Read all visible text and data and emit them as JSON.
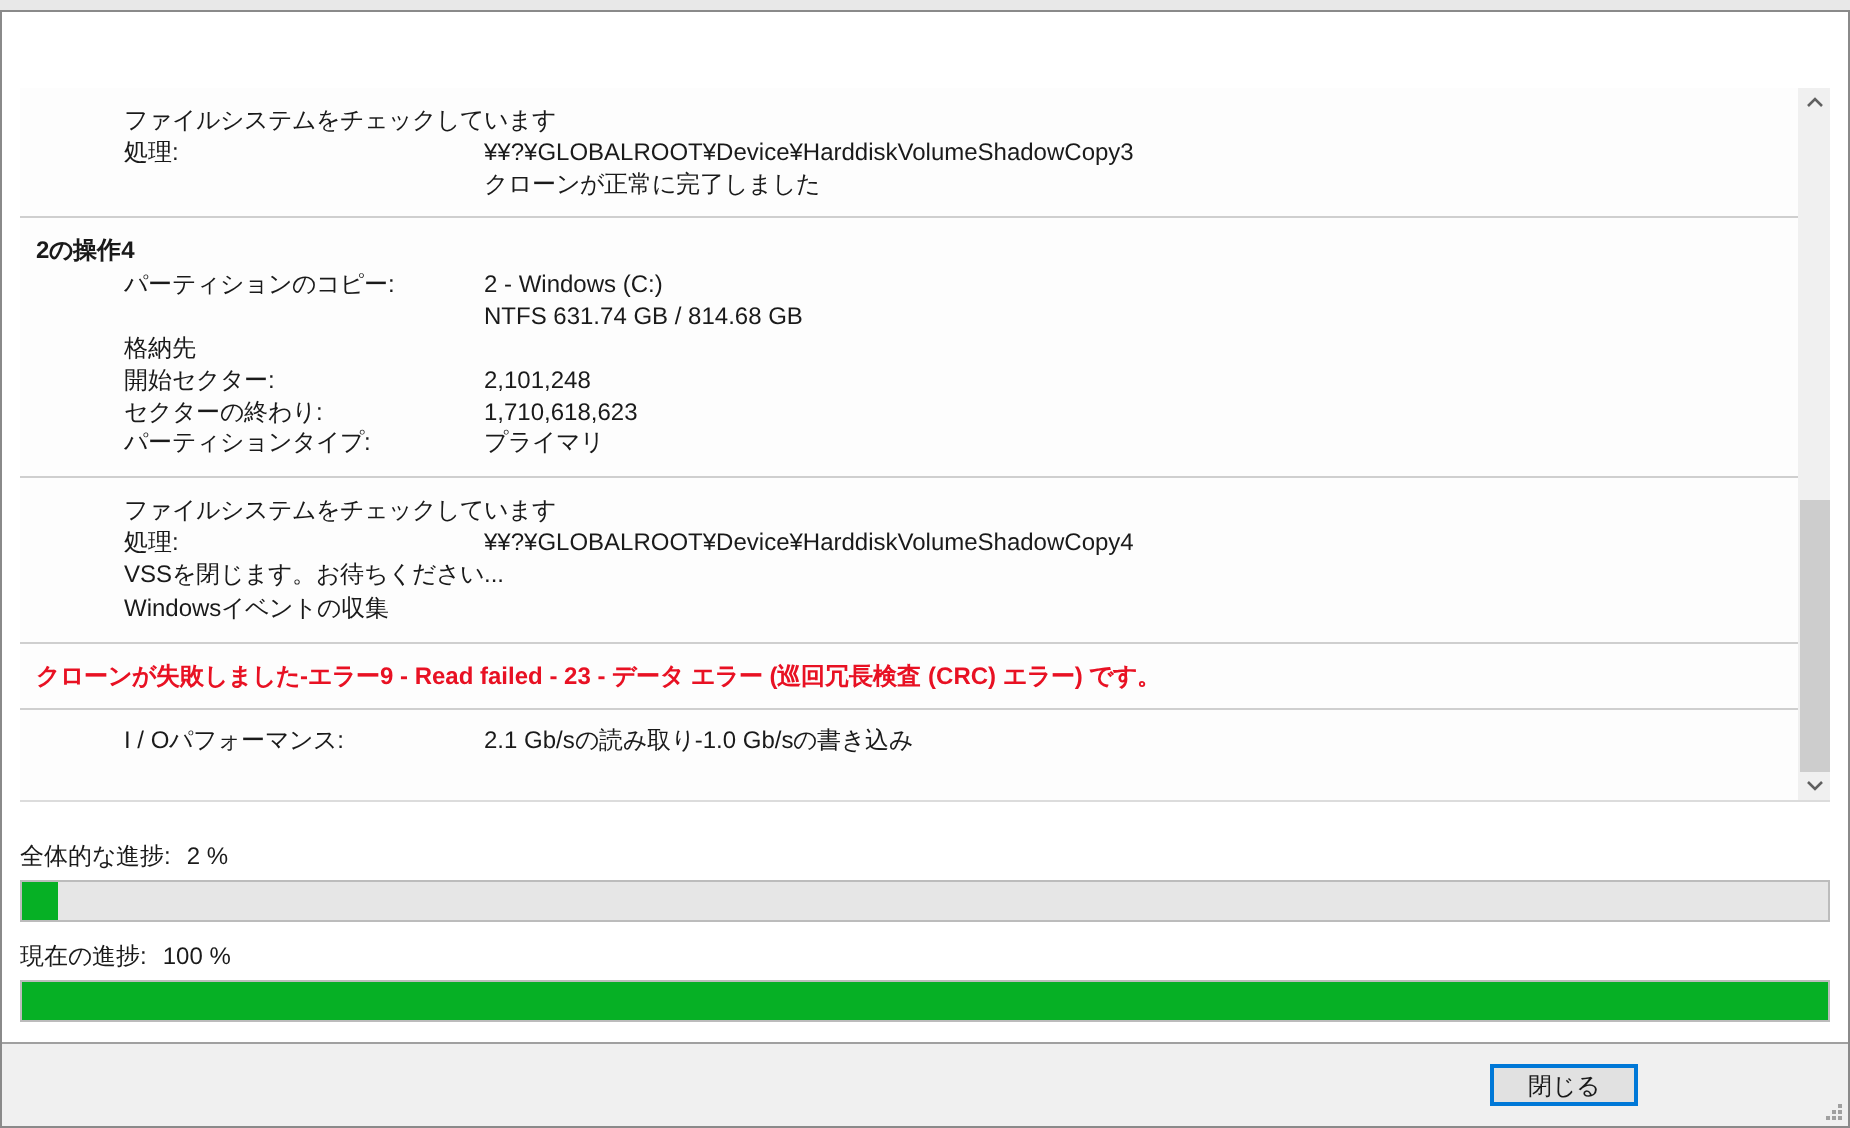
{
  "log": {
    "sections": [
      {
        "rows": [
          {
            "kind": "text",
            "text": "ファイルシステムをチェックしています"
          },
          {
            "kind": "pair",
            "label": "処理:",
            "values": [
              "¥¥?¥GLOBALROOT¥Device¥HarddiskVolumeShadowCopy3",
              "クローンが正常に完了しました"
            ]
          }
        ]
      },
      {
        "heading": "2の操作4",
        "rows": [
          {
            "kind": "pair",
            "label": "パーティションのコピー:",
            "values": [
              "2 - Windows (C:)",
              "NTFS 631.74 GB / 814.68 GB"
            ]
          },
          {
            "kind": "text",
            "text": "格納先"
          },
          {
            "kind": "pair",
            "label": "開始セクター:",
            "values": [
              "2,101,248"
            ]
          },
          {
            "kind": "pair",
            "label": "セクターの終わり:",
            "values": [
              "1,710,618,623"
            ]
          },
          {
            "kind": "pair",
            "label": "パーティションタイプ:",
            "values": [
              "プライマリ"
            ]
          }
        ]
      },
      {
        "rows": [
          {
            "kind": "text",
            "text": "ファイルシステムをチェックしています"
          },
          {
            "kind": "pair",
            "label": "処理:",
            "values": [
              "¥¥?¥GLOBALROOT¥Device¥HarddiskVolumeShadowCopy4"
            ]
          },
          {
            "kind": "text",
            "text": "VSSを閉じます。お待ちください..."
          },
          {
            "kind": "text",
            "text": "Windowsイベントの収集"
          }
        ]
      },
      {
        "rows": [
          {
            "kind": "error",
            "text": "クローンが失敗しました-エラー9 - Read failed - 23 - データ エラー (巡回冗長検査 (CRC) エラー) です。"
          }
        ]
      },
      {
        "rows": [
          {
            "kind": "pair",
            "label": "I / Oパフォーマンス:",
            "values": [
              "2.1 Gb/sの読み取り-1.0 Gb/sの書き込み"
            ]
          }
        ]
      }
    ]
  },
  "progress": [
    {
      "label": "全体的な進捗:",
      "reading": "2 %",
      "level": 0.02
    },
    {
      "label": "現在の進捗:",
      "reading": "100 %",
      "level": 1
    }
  ],
  "buttons": [
    {
      "label": "閉じる",
      "focused": true
    }
  ]
}
